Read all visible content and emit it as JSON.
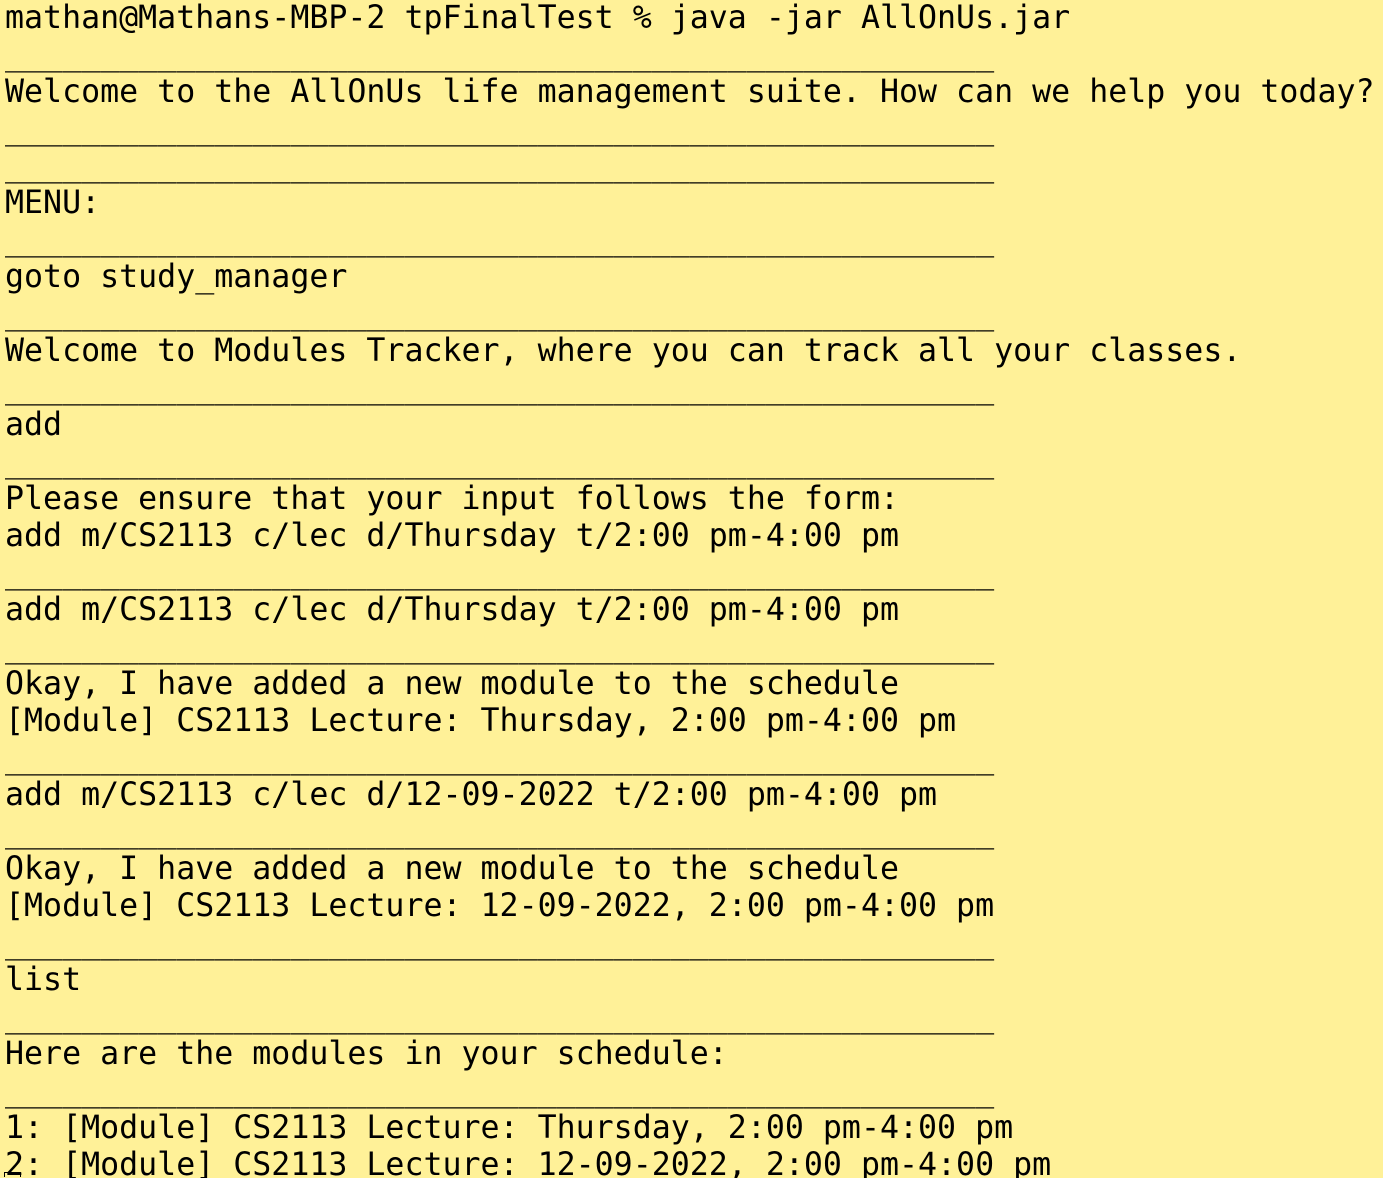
{
  "terminal": {
    "background_color": "#fff198",
    "text_color": "#000000",
    "lines": [
      "mathan@Mathans-MBP-2 tpFinalTest % java -jar AllOnUs.jar",
      "____________________________________________________",
      "Welcome to the AllOnUs life management suite. How can we help you today?",
      "____________________________________________________",
      "____________________________________________________",
      "MENU:",
      "____________________________________________________",
      "goto study_manager",
      "____________________________________________________",
      "Welcome to Modules Tracker, where you can track all your classes.",
      "____________________________________________________",
      "add",
      "____________________________________________________",
      "Please ensure that your input follows the form:",
      "add m/CS2113 c/lec d/Thursday t/2:00 pm-4:00 pm",
      "____________________________________________________",
      "add m/CS2113 c/lec d/Thursday t/2:00 pm-4:00 pm",
      "____________________________________________________",
      "Okay, I have added a new module to the schedule",
      "[Module] CS2113 Lecture: Thursday, 2:00 pm-4:00 pm",
      "____________________________________________________",
      "add m/CS2113 c/lec d/12-09-2022 t/2:00 pm-4:00 pm",
      "____________________________________________________",
      "Okay, I have added a new module to the schedule",
      "[Module] CS2113 Lecture: 12-09-2022, 2:00 pm-4:00 pm",
      "____________________________________________________",
      "list",
      "____________________________________________________",
      "Here are the modules in your schedule:",
      "____________________________________________________",
      "1: [Module] CS2113 Lecture: Thursday, 2:00 pm-4:00 pm",
      "2: [Module] CS2113 Lecture: 12-09-2022, 2:00 pm-4:00 pm"
    ]
  }
}
